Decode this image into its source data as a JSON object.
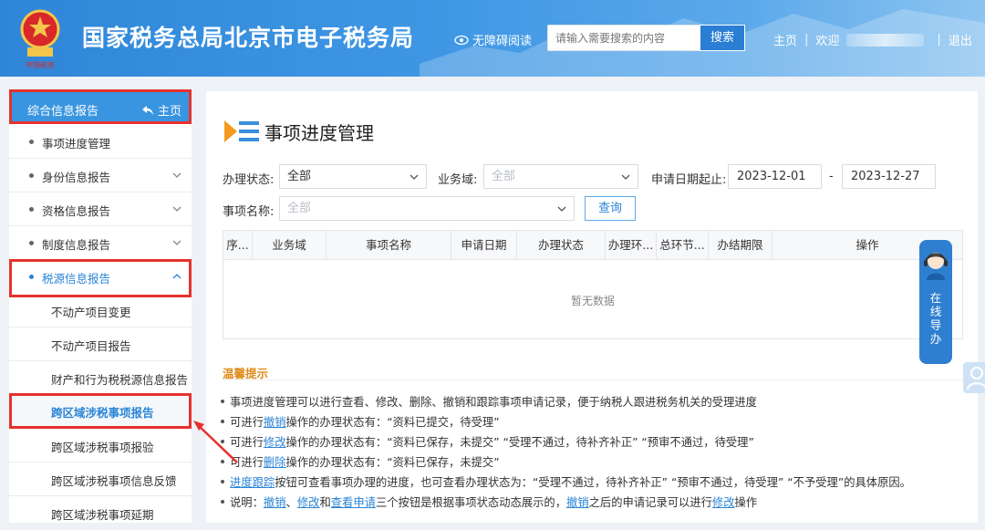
{
  "header": {
    "title": "国家税务总局北京市电子税务局",
    "emblem_caption": "中国税务",
    "accessibility": "无障碍阅读",
    "search_placeholder": "请输入需要搜索的内容",
    "search_button": "搜索",
    "nav_home": "主页",
    "nav_welcome": "欢迎",
    "nav_logout": "退出"
  },
  "sidebar": {
    "head_label": "综合信息报告",
    "head_home": "主页",
    "items": [
      {
        "label": "事项进度管理"
      },
      {
        "label": "身份信息报告"
      },
      {
        "label": "资格信息报告"
      },
      {
        "label": "制度信息报告"
      },
      {
        "label": "税源信息报告"
      }
    ],
    "sub_items": [
      {
        "label": "不动产项目变更"
      },
      {
        "label": "不动产项目报告"
      },
      {
        "label": "财产和行为税税源信息报告"
      },
      {
        "label": "跨区域涉税事项报告"
      },
      {
        "label": "跨区域涉税事项报验"
      },
      {
        "label": "跨区域涉税事项信息反馈"
      },
      {
        "label": "跨区域涉税事项延期"
      }
    ]
  },
  "main": {
    "title": "事项进度管理",
    "filters": {
      "status_label": "办理状态:",
      "status_value": "全部",
      "domain_label": "业务域:",
      "domain_value": "全部",
      "date_label": "申请日期起止:",
      "date_start": "2023-12-01",
      "date_sep": "-",
      "date_end": "2023-12-27",
      "name_label": "事项名称:",
      "name_value": "全部",
      "query_button": "查询"
    },
    "table": {
      "columns": [
        "序...",
        "业务域",
        "事项名称",
        "申请日期",
        "办理状态",
        "办理环...",
        "总环节...",
        "办结期限",
        "操作"
      ],
      "empty_text": "暂无数据"
    },
    "tips": {
      "title": "温馨提示",
      "line1": "事项进度管理可以进行查看、修改、删除、撤销和跟踪事项申请记录，便于纳税人跟进税务机关的受理进度",
      "line2_pre": "可进行",
      "line2_link": "撤销",
      "line2_post": "操作的办理状态有：“资料已提交，待受理”",
      "line3_pre": "可进行",
      "line3_link": "修改",
      "line3_post": "操作的办理状态有：“资料已保存，未提交” “受理不通过，待补齐补正” “预审不通过，待受理”",
      "line4_pre": "可进行",
      "line4_link": "删除",
      "line4_post": "操作的办理状态有：“资料已保存，未提交”",
      "line5_link": "进度跟踪",
      "line5_post": "按钮可查看事项办理的进度，也可查看办理状态为：“受理不通过，待补齐补正” “预审不通过，待受理” “不予受理”的具体原因。",
      "line6_pre": "说明：",
      "line6_link1": "撤销",
      "line6_sep1": "、",
      "line6_link2": "修改",
      "line6_sep2": "和",
      "line6_link3": "查看申请",
      "line6_mid": "三个按钮是根据事项状态动态展示的，",
      "line6_link4": "撤销",
      "line6_mid2": "之后的申请记录可以进行",
      "line6_link5": "修改",
      "line6_end": "操作"
    }
  },
  "widgets": {
    "online_guide": "在线导办"
  },
  "colors": {
    "header_blue": "#3a8fdf",
    "accent_blue": "#2a84d6",
    "highlight_red": "#e5322d",
    "tips_orange": "#e08a1b"
  }
}
